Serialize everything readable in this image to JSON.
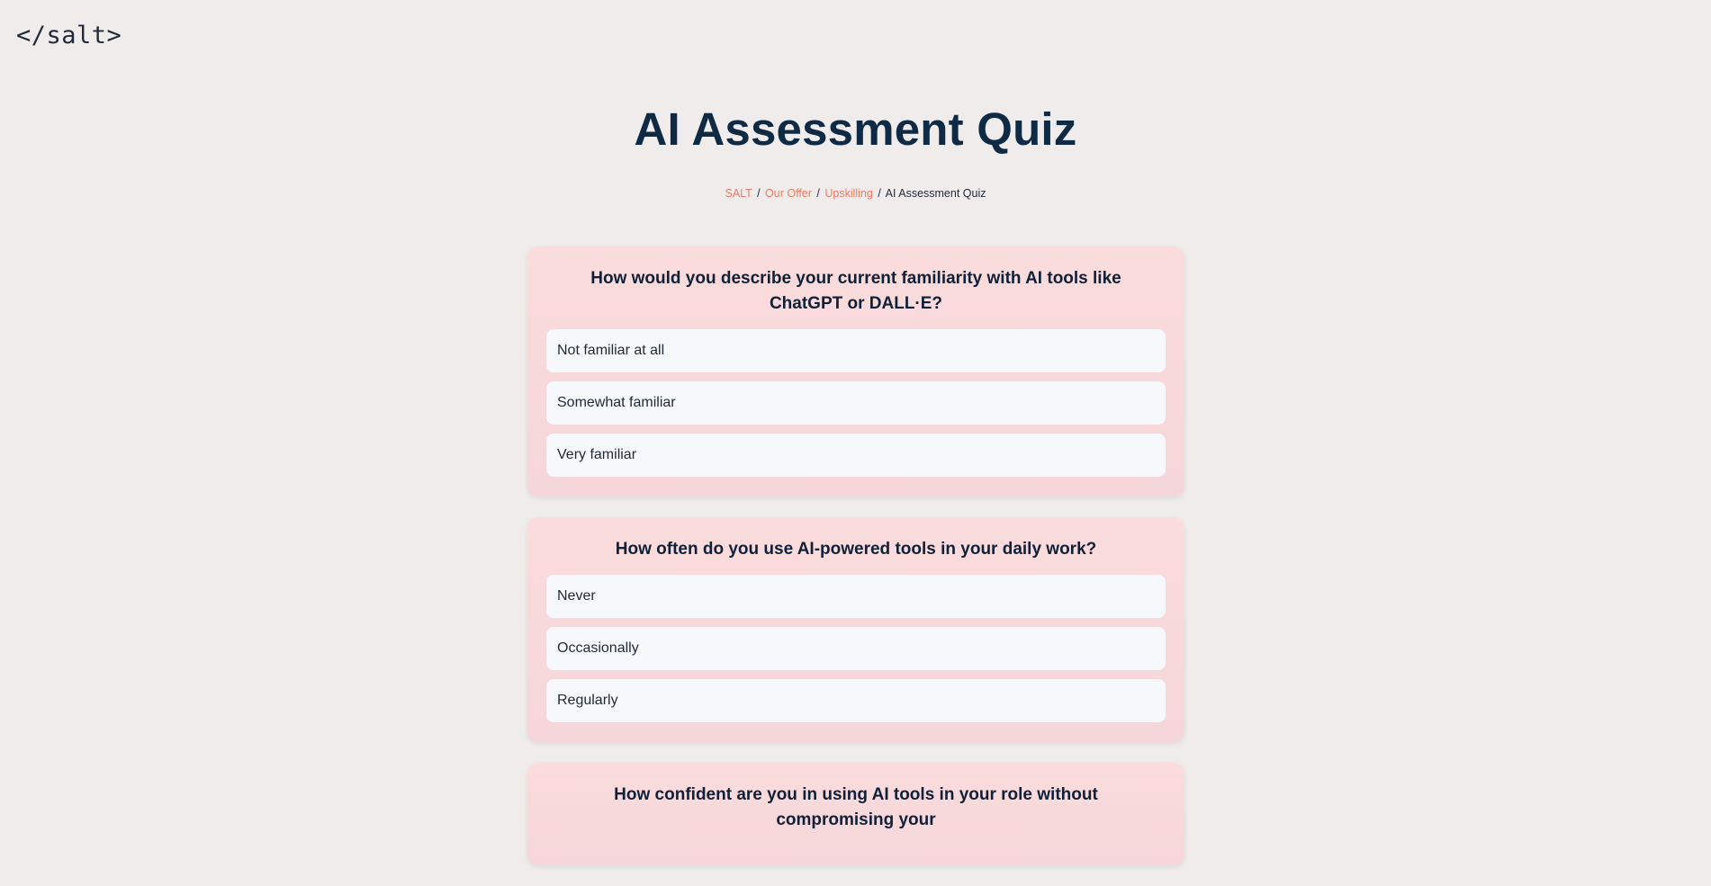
{
  "logo": "</salt>",
  "page_title": "AI Assessment Quiz",
  "breadcrumb": {
    "items": [
      "SALT",
      "Our Offer",
      "Upskilling"
    ],
    "separator": "/",
    "current": "AI Assessment Quiz"
  },
  "questions": [
    {
      "text": "How would you describe your current familiarity with AI tools like ChatGPT or DALL·E?",
      "options": [
        "Not familiar at all",
        "Somewhat familiar",
        "Very familiar"
      ]
    },
    {
      "text": "How often do you use AI-powered tools in your daily work?",
      "options": [
        "Never",
        "Occasionally",
        "Regularly"
      ]
    },
    {
      "text": "How confident are you in using AI tools in your role without compromising your",
      "options": []
    }
  ],
  "colors": {
    "background": "#f0ecec",
    "title": "#0f2a44",
    "link_accent": "#f07c62",
    "card_background": "#fbdcdc",
    "option_background": "#f7f8fb"
  }
}
